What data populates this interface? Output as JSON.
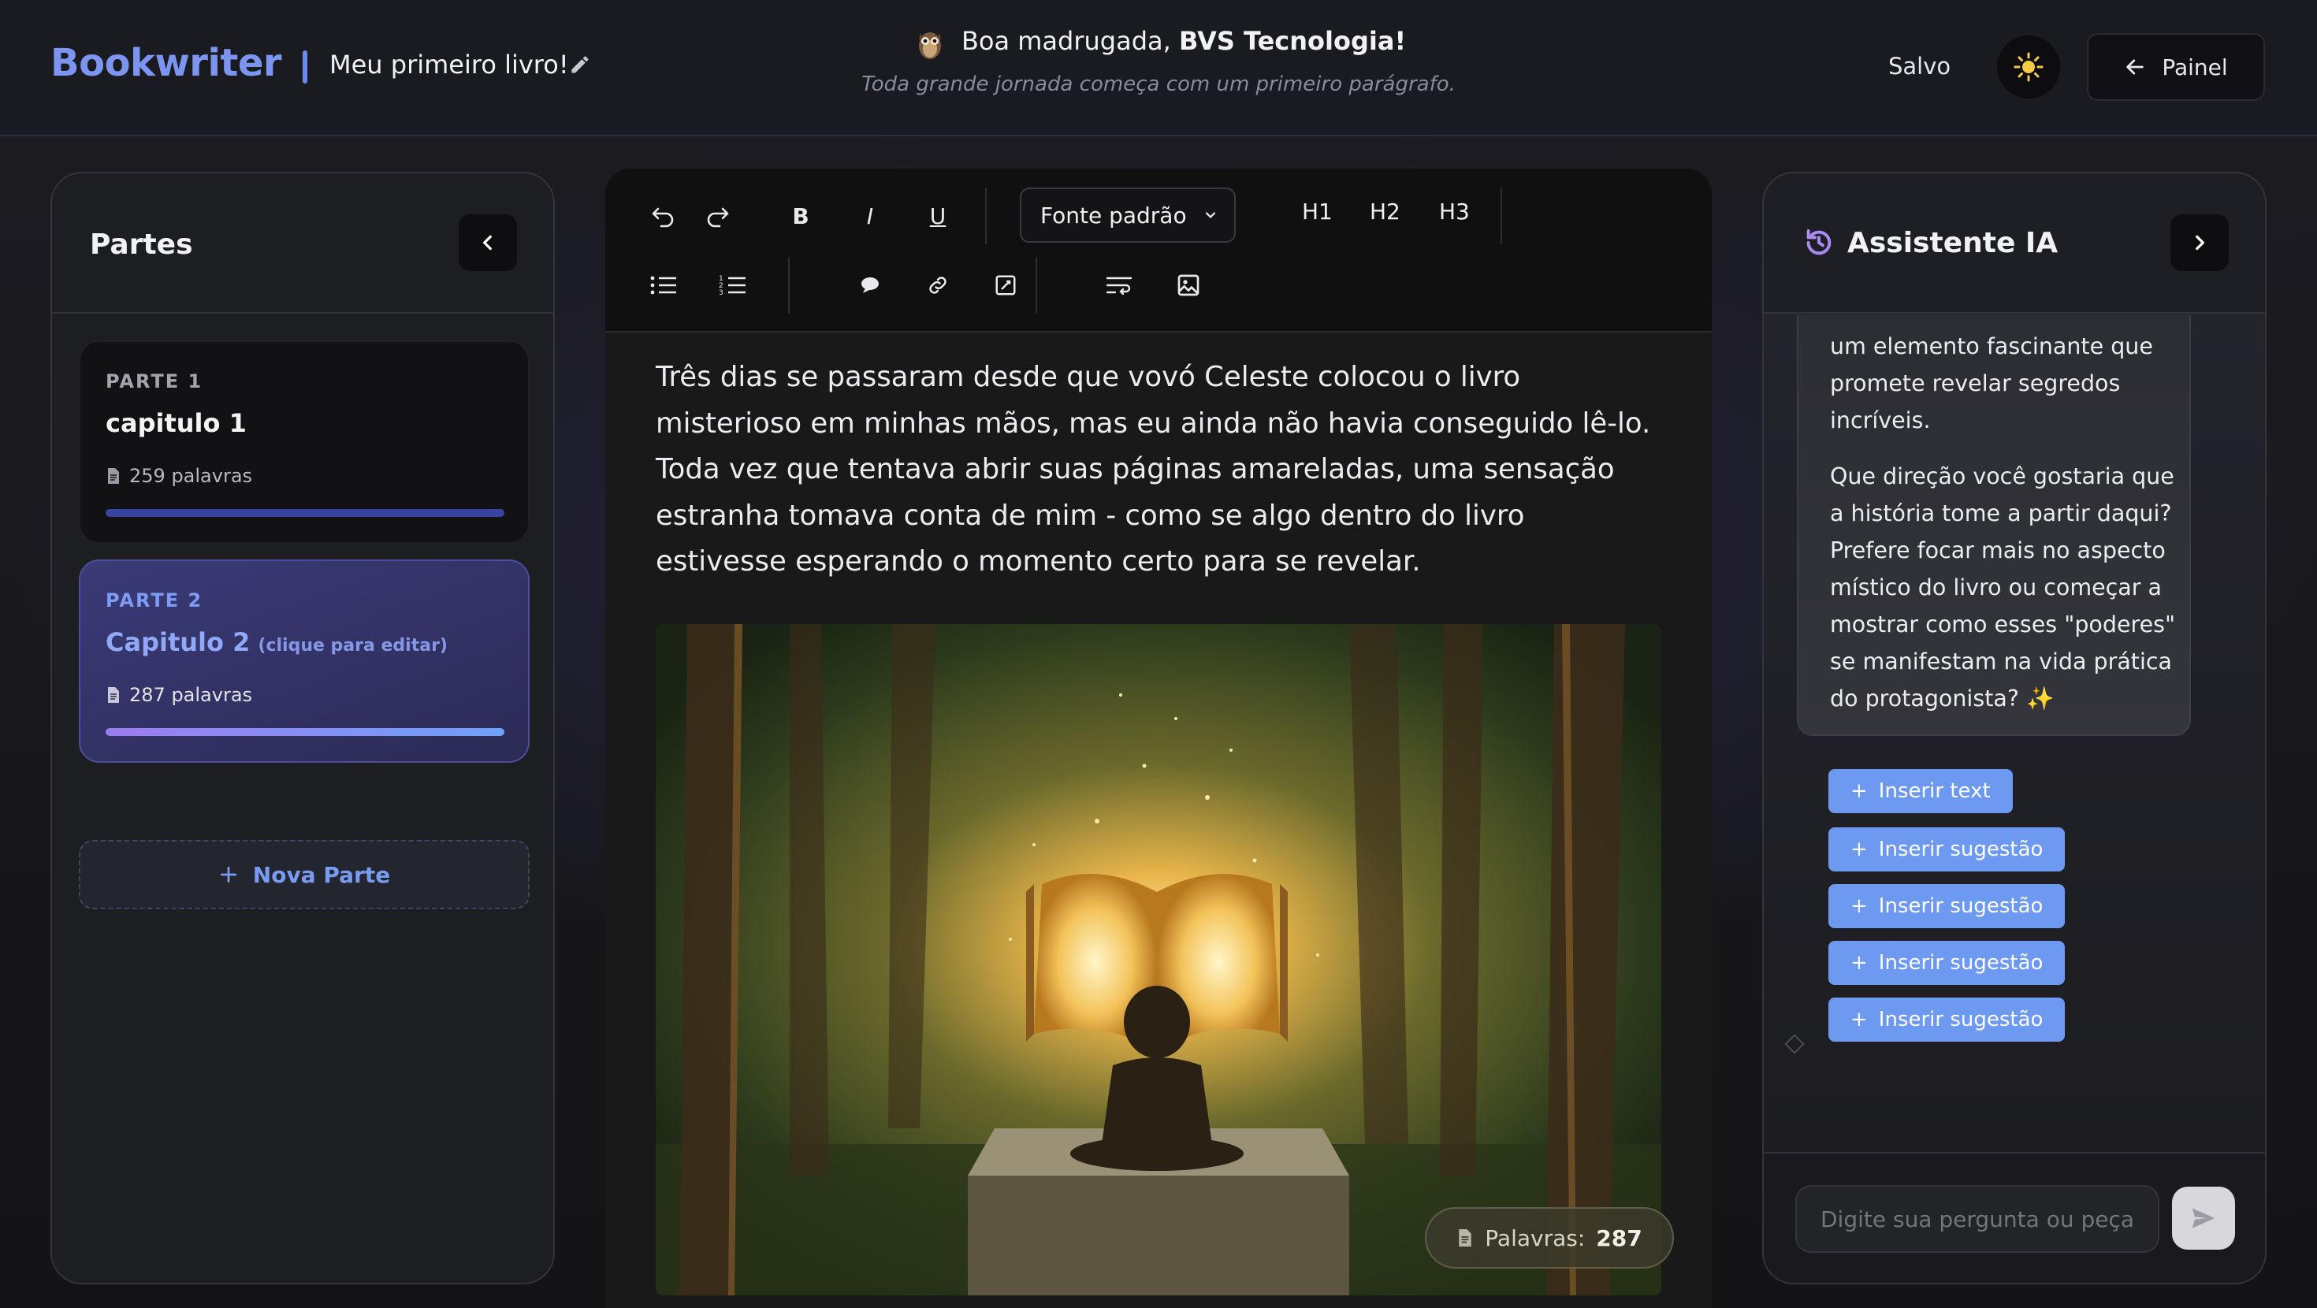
{
  "header": {
    "brand": "Bookwriter",
    "book_title": "Meu primeiro livro!",
    "greeting_prefix": "Boa madrugada,",
    "greeting_name": "BVS Tecnologia!",
    "tagline": "Toda grande jornada começa com um primeiro parágrafo.",
    "save_status": "Salvo",
    "panel_button": "Painel"
  },
  "sidebar": {
    "title": "Partes",
    "parts": [
      {
        "label": "PARTE 1",
        "title": "capitulo 1",
        "hint": "",
        "words": "259 palavras",
        "active": false
      },
      {
        "label": "PARTE 2",
        "title": "Capitulo 2",
        "hint": "(clique para editar)",
        "words": "287 palavras",
        "active": true
      }
    ],
    "new_part": "Nova Parte"
  },
  "toolbar": {
    "bold": "B",
    "italic": "I",
    "underline": "U",
    "font_select": "Fonte padrão",
    "h1": "H1",
    "h2": "H2",
    "h3": "H3"
  },
  "editor": {
    "paragraph": "Três dias se passaram desde que vovó Celeste colocou o livro misterioso em minhas mãos, mas eu ainda não havia conseguido lê-lo. Toda vez que tentava abrir suas páginas amareladas, uma sensação estranha tomava conta de mim - como se algo dentro do livro estivesse esperando o momento certo para se revelar.",
    "word_count_label": "Palavras:",
    "word_count": "287"
  },
  "assistant": {
    "title": "Assistente IA",
    "message_part1": "um elemento fascinante que promete revelar segredos incríveis.",
    "message_part2": "Que direção você gostaria que a história tome a partir daqui? Prefere focar mais no aspecto místico do livro ou começar a mostrar como esses \"poderes\" se manifestam na vida prática do protagonista? ✨",
    "actions": [
      "Inserir text",
      "Inserir sugestão",
      "Inserir sugestão",
      "Inserir sugestão",
      "Inserir sugestão"
    ],
    "input_placeholder": "Digite sua pergunta ou peça s"
  },
  "icons": {
    "edit": "pencil-icon",
    "mascot": "owl-icon",
    "theme": "sun-icon",
    "back": "arrow-left-icon",
    "history": "history-icon",
    "send": "send-icon"
  },
  "colors": {
    "accent": "#7b95f0",
    "action_button": "#6d9af0",
    "active_part": "#3a3a78"
  }
}
